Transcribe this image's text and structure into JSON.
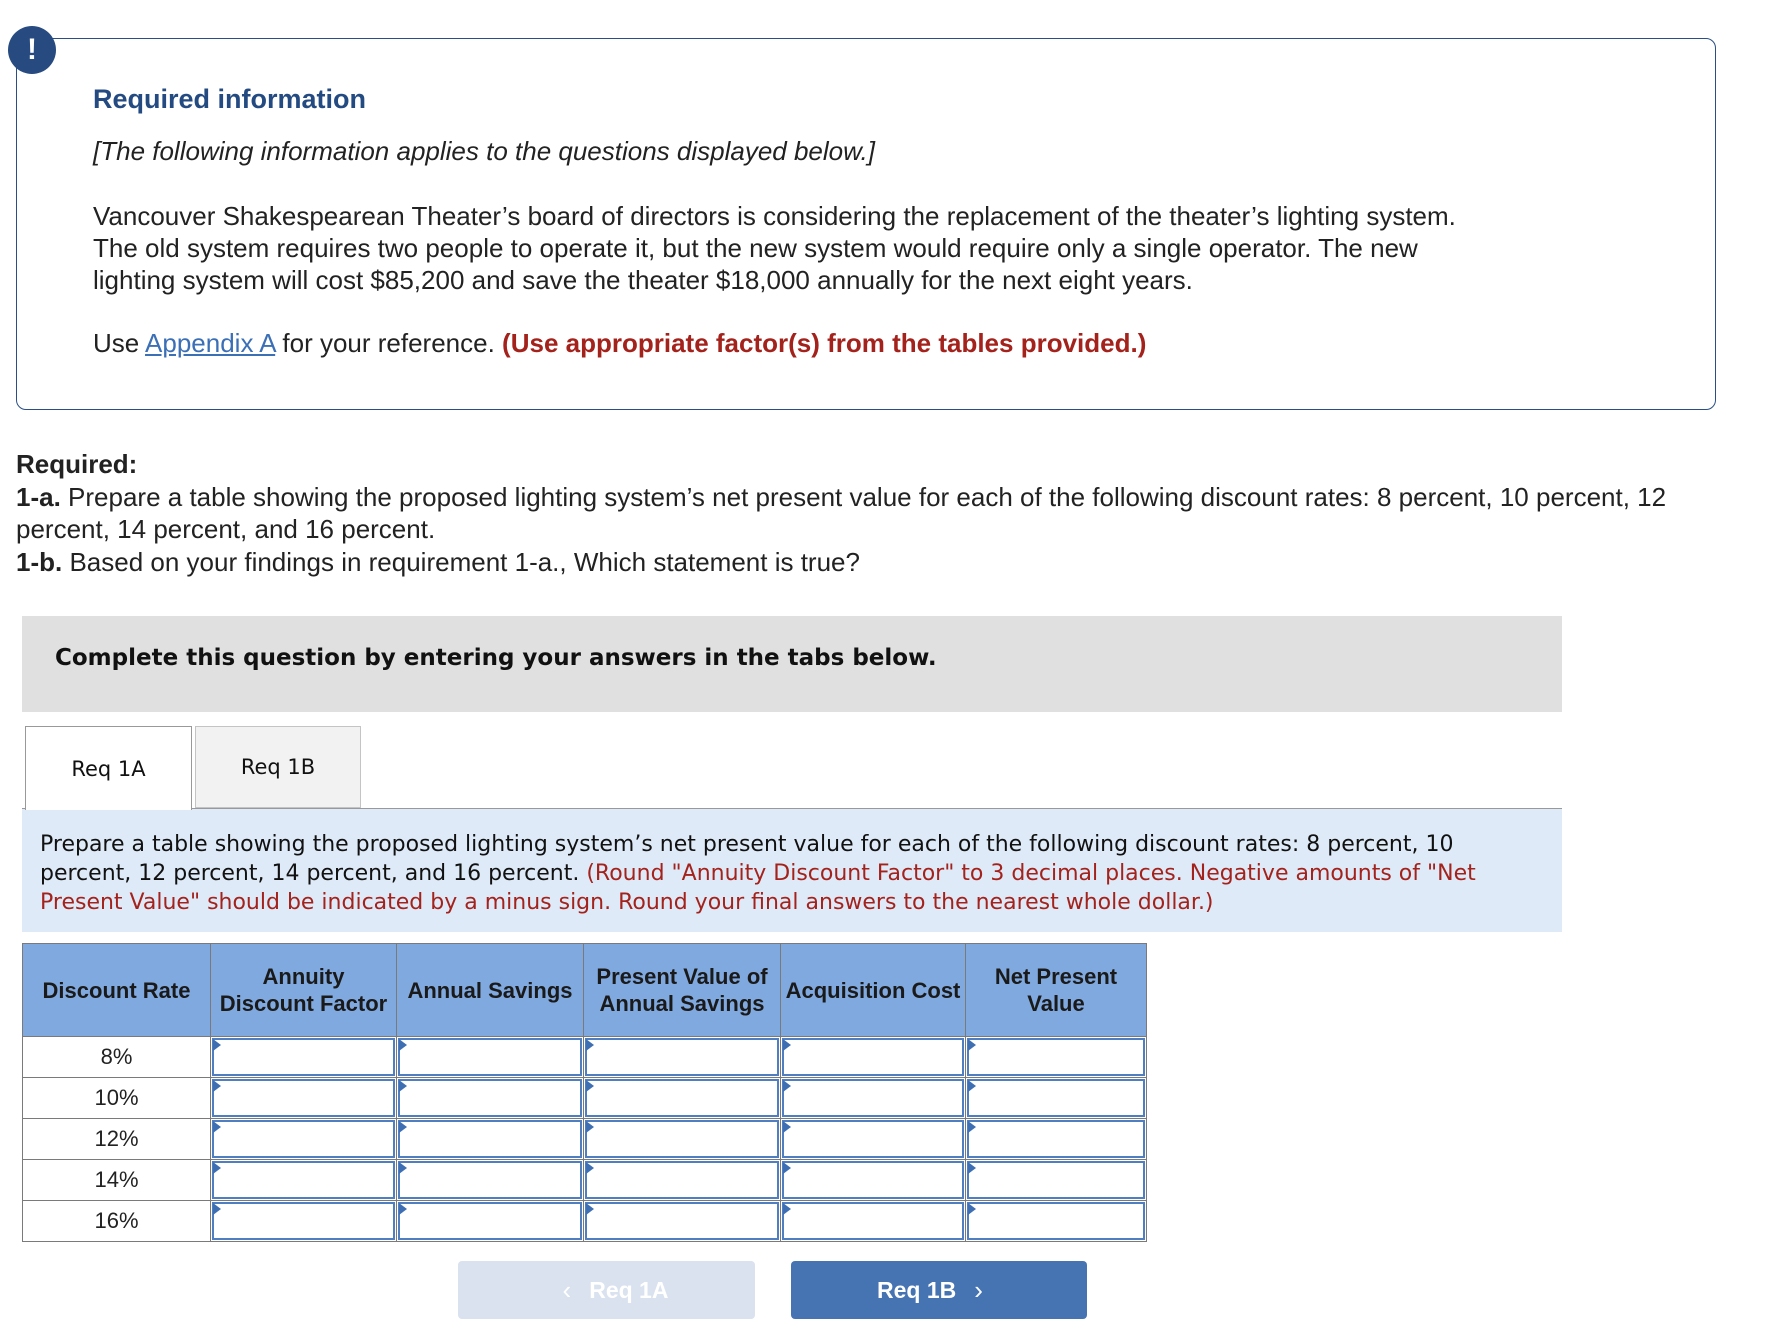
{
  "alert": {
    "icon": "!"
  },
  "info": {
    "title": "Required information",
    "subtitle": "[The following information applies to the questions displayed below.]",
    "body_lines": [
      "Vancouver Shakespearean Theater’s board of directors is considering the replacement of the theater’s lighting system.",
      "The old system requires two people to operate it, but the new system would require only a single operator. The new",
      "lighting system will cost $85,200 and save the theater $18,000 annually for the next eight years."
    ],
    "ref_prefix": "Use ",
    "ref_link": "Appendix A",
    "ref_middle": " for your reference. ",
    "ref_warning": "(Use appropriate factor(s) from the tables provided.)"
  },
  "required": {
    "heading": "Required:",
    "item_1a_label": "1-a.",
    "item_1a_text": " Prepare a table showing the proposed lighting system’s net present value for each of the following discount rates: 8 percent, 10 percent, 12 percent, 14 percent, and 16 percent.",
    "item_1b_label": "1-b.",
    "item_1b_text": " Based on your findings in requirement 1-a., Which statement is true?"
  },
  "instruction": "Complete this question by entering your answers in the tabs below.",
  "tabs": [
    {
      "label": "Req 1A",
      "active": true
    },
    {
      "label": "Req 1B",
      "active": false
    }
  ],
  "panel": {
    "text": "Prepare a table showing the proposed lighting system’s net present value for each of the following discount rates: 8 percent, 10 percent, 12 percent, 14 percent, and 16 percent. ",
    "note": "(Round \"Annuity Discount Factor\" to 3 decimal places. Negative amounts of \"Net Present Value\" should be indicated by a minus sign. Round your final answers to the nearest whole dollar.)"
  },
  "table": {
    "headers": [
      "Discount Rate",
      "Annuity Discount Factor",
      "Annual Savings",
      "Present Value of Annual Savings",
      "Acquisition Cost",
      "Net Present Value"
    ],
    "rows": [
      {
        "rate": "8%",
        "values": [
          "",
          "",
          "",
          "",
          ""
        ]
      },
      {
        "rate": "10%",
        "values": [
          "",
          "",
          "",
          "",
          ""
        ]
      },
      {
        "rate": "12%",
        "values": [
          "",
          "",
          "",
          "",
          ""
        ]
      },
      {
        "rate": "14%",
        "values": [
          "",
          "",
          "",
          "",
          ""
        ]
      },
      {
        "rate": "16%",
        "values": [
          "",
          "",
          "",
          "",
          ""
        ]
      }
    ]
  },
  "nav": {
    "prev_label": "Req 1A",
    "prev_icon": "‹",
    "next_label": "Req 1B",
    "next_icon": "›"
  },
  "colors": {
    "brand_navy": "#274b80",
    "warning_red": "#a4221c",
    "link_blue": "#3b6fb6",
    "table_header": "#80a9df",
    "next_button": "#4674b3",
    "prev_button_disabled": "#d9e2ee"
  }
}
